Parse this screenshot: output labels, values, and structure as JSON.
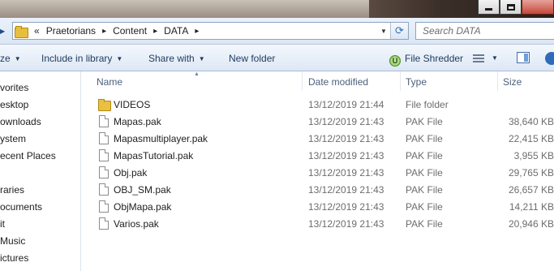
{
  "window": {
    "buttons": {
      "minimize": "minimize",
      "maximize": "maximize",
      "close": "close"
    }
  },
  "address": {
    "overflow": "«",
    "crumbs": [
      "Praetorians",
      "Content",
      "DATA"
    ],
    "search_placeholder": "Search DATA"
  },
  "toolbar": {
    "organize": "ze",
    "include_in_library": "Include in library",
    "share_with": "Share with",
    "new_folder": "New folder",
    "file_shredder": "File Shredder"
  },
  "nav": {
    "items": [
      "vorites",
      "esktop",
      "ownloads",
      "ystem",
      "ecent Places",
      "raries",
      "ocuments",
      "it",
      "Music",
      "ictures"
    ]
  },
  "columns": {
    "name": "Name",
    "date": "Date modified",
    "type": "Type",
    "size": "Size"
  },
  "files": [
    {
      "name": "VIDEOS",
      "date": "13/12/2019 21:44",
      "type": "File folder",
      "size": "",
      "icon": "folder-icon"
    },
    {
      "name": "Mapas.pak",
      "date": "13/12/2019 21:43",
      "type": "PAK File",
      "size": "38,640 KB",
      "icon": "file-icon"
    },
    {
      "name": "Mapasmultiplayer.pak",
      "date": "13/12/2019 21:43",
      "type": "PAK File",
      "size": "22,415 KB",
      "icon": "file-icon"
    },
    {
      "name": "MapasTutorial.pak",
      "date": "13/12/2019 21:43",
      "type": "PAK File",
      "size": "3,955 KB",
      "icon": "file-icon"
    },
    {
      "name": "Obj.pak",
      "date": "13/12/2019 21:43",
      "type": "PAK File",
      "size": "29,765 KB",
      "icon": "file-icon"
    },
    {
      "name": "OBJ_SM.pak",
      "date": "13/12/2019 21:43",
      "type": "PAK File",
      "size": "26,657 KB",
      "icon": "file-icon"
    },
    {
      "name": "ObjMapa.pak",
      "date": "13/12/2019 21:43",
      "type": "PAK File",
      "size": "14,211 KB",
      "icon": "file-icon"
    },
    {
      "name": "Varios.pak",
      "date": "13/12/2019 21:43",
      "type": "PAK File",
      "size": "20,946 KB",
      "icon": "file-icon"
    }
  ]
}
